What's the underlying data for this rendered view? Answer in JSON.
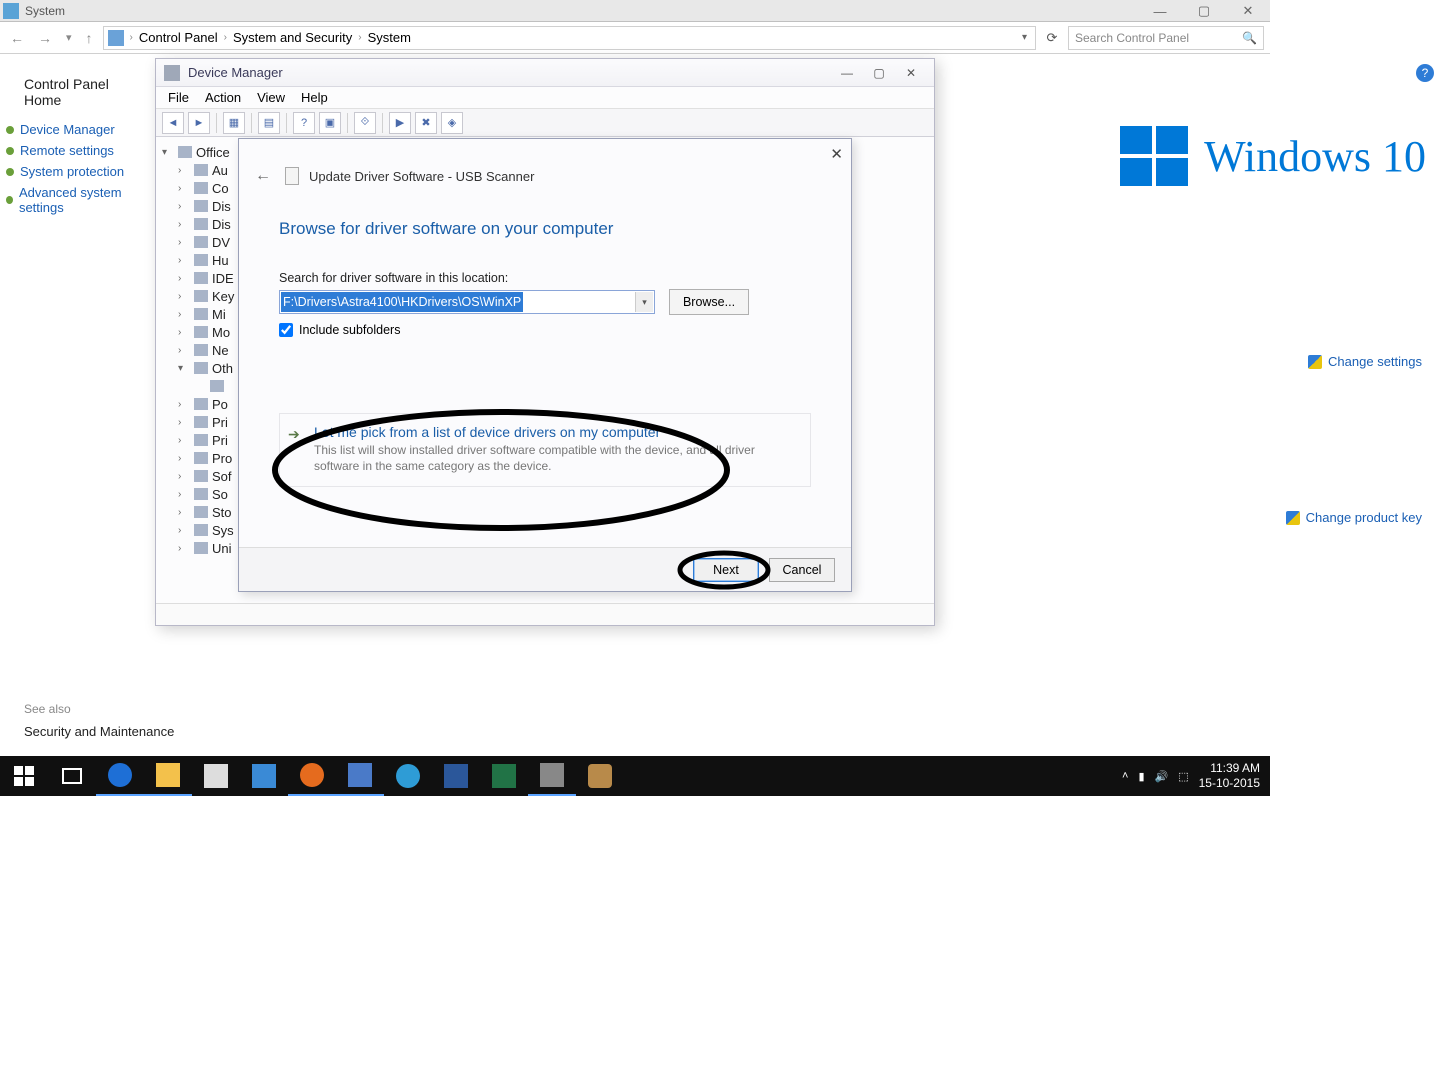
{
  "system_window": {
    "title": "System"
  },
  "breadcrumb": {
    "parts": [
      "Control Panel",
      "System and Security",
      "System"
    ]
  },
  "search": {
    "placeholder": "Search Control Panel"
  },
  "cp_sidebar": {
    "home": "Control Panel Home",
    "links": [
      "Device Manager",
      "Remote settings",
      "System protection",
      "Advanced system settings"
    ]
  },
  "see_also": {
    "heading": "See also",
    "link": "Security and Maintenance"
  },
  "right_pane": {
    "logo_text": "Windows 10",
    "change_settings": "Change settings",
    "change_key": "Change product key"
  },
  "dm": {
    "title": "Device Manager",
    "menus": [
      "File",
      "Action",
      "View",
      "Help"
    ],
    "root": "Office",
    "nodes": [
      "Au",
      "Co",
      "Dis",
      "Dis",
      "DV",
      "Hu",
      "IDE",
      "Key",
      "Mi",
      "Mo",
      "Ne",
      "Oth",
      "",
      "Po",
      "Pri",
      "Pri",
      "Pro",
      "Sof",
      "So",
      "Sto",
      "Sys",
      "Uni"
    ]
  },
  "wizard": {
    "title": "Update Driver Software - USB Scanner",
    "heading": "Browse for driver software on your computer",
    "search_label": "Search for driver software in this location:",
    "path": "F:\\Drivers\\Astra4100\\HKDrivers\\OS\\WinXP",
    "browse": "Browse...",
    "include_subfolders": "Include subfolders",
    "option_title": "Let me pick from a list of device drivers on my computer",
    "option_desc": "This list will show installed driver software compatible with the device, and all driver software in the same category as the device.",
    "next": "Next",
    "cancel": "Cancel"
  },
  "taskbar": {
    "time": "11:39 AM",
    "date": "15-10-2015"
  }
}
